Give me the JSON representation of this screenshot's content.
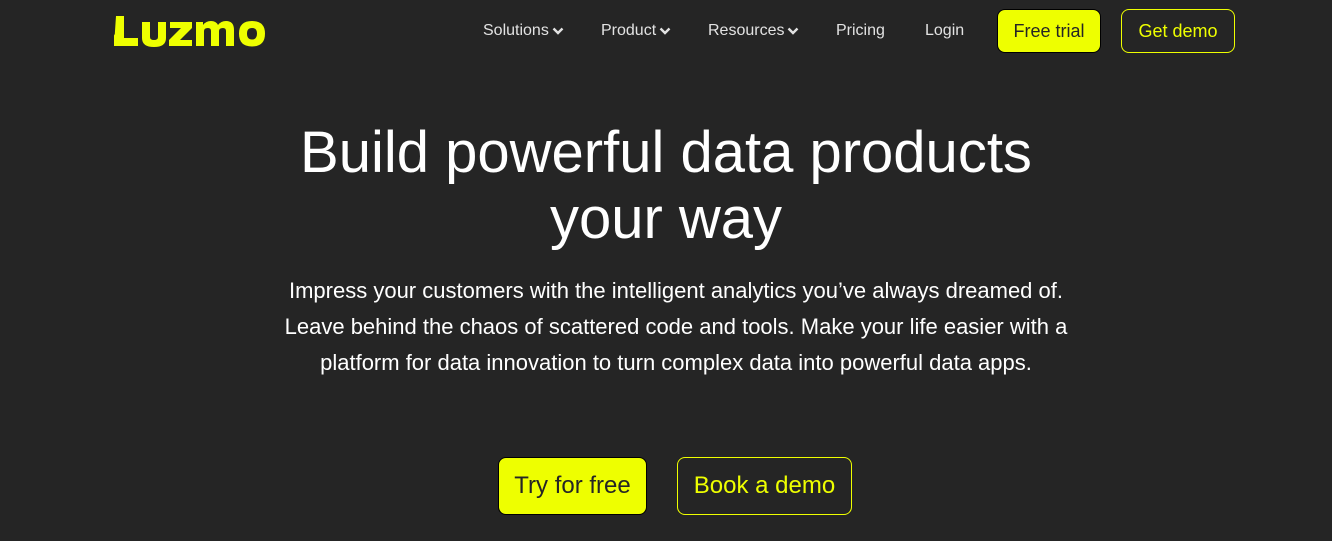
{
  "brand": {
    "logo_text": "Luzmo",
    "accent_color": "#eeff00",
    "background_color": "#252525"
  },
  "nav": {
    "items": [
      {
        "label": "Solutions",
        "has_dropdown": true,
        "icon": "chevron-down-icon"
      },
      {
        "label": "Product",
        "has_dropdown": true,
        "icon": "chevron-down-icon"
      },
      {
        "label": "Resources",
        "has_dropdown": true,
        "icon": "chevron-down-icon"
      },
      {
        "label": "Pricing",
        "has_dropdown": false
      },
      {
        "label": "Login",
        "has_dropdown": false
      }
    ],
    "free_trial_label": "Free trial",
    "get_demo_label": "Get demo"
  },
  "hero": {
    "headline_line1": "Build powerful data products",
    "headline_line2": "your way",
    "description": "Impress your customers with the intelligent analytics you’ve always dreamed of. Leave behind the chaos of scattered code and tools. Make your life easier with a platform for data innovation to turn complex data into powerful data apps.",
    "primary_cta_label": "Try for free",
    "secondary_cta_label": "Book a demo"
  }
}
